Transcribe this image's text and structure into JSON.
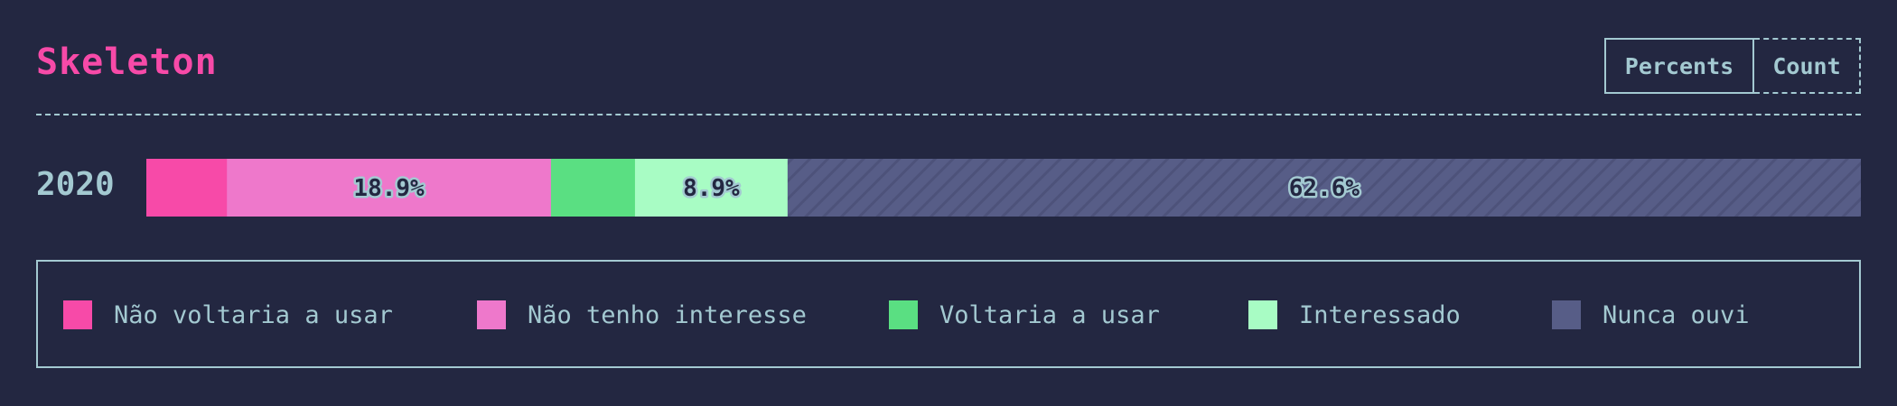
{
  "title": "Skeleton",
  "toggle": {
    "percents_label": "Percents",
    "count_label": "Count"
  },
  "chart_data": {
    "type": "bar",
    "orientation": "horizontal",
    "stacked": true,
    "title": "Skeleton",
    "categories": [
      "2020"
    ],
    "series": [
      {
        "name": "Não voltaria a usar",
        "values": [
          4.7
        ],
        "color": "#f74aa8",
        "label": ""
      },
      {
        "name": "Não tenho interesse",
        "values": [
          18.9
        ],
        "color": "#ee78cb",
        "label": "18.9%"
      },
      {
        "name": "Voltaria a usar",
        "values": [
          4.9
        ],
        "color": "#5adf82",
        "label": ""
      },
      {
        "name": "Interessado",
        "values": [
          8.9
        ],
        "color": "#a8fcc4",
        "label": "8.9%"
      },
      {
        "name": "Nunca ouvi",
        "values": [
          62.6
        ],
        "color": "#575d87",
        "label": "62.6%",
        "pattern": "hatched"
      }
    ],
    "xlim": [
      0,
      100
    ],
    "legend_position": "bottom"
  }
}
